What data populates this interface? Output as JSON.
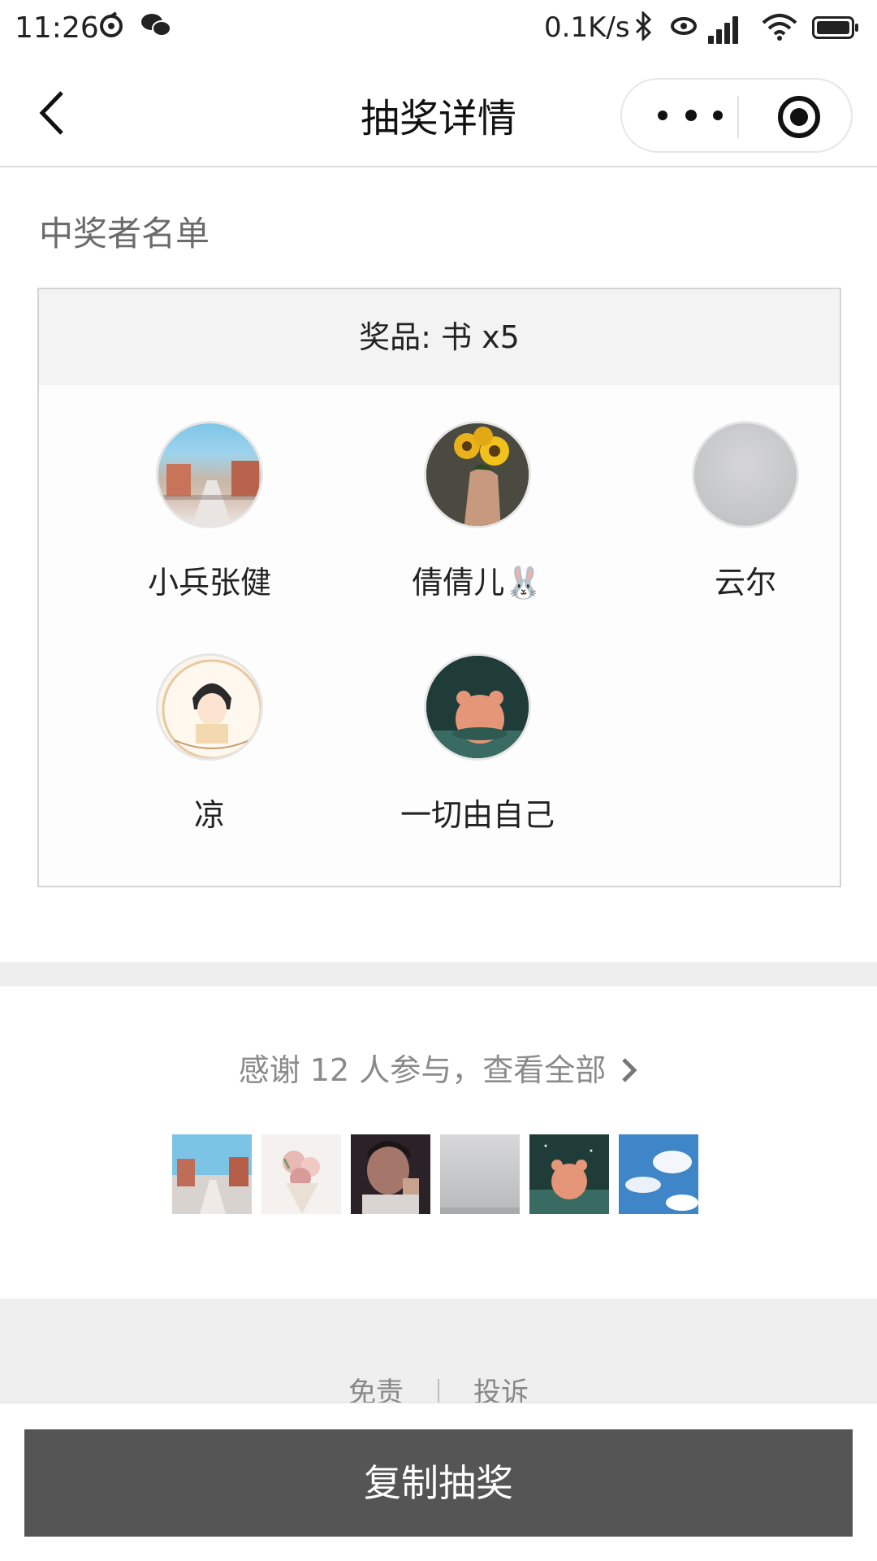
{
  "status_bar": {
    "time": "11:26",
    "net_speed": "0.1K/s",
    "icons": [
      "netease-music-icon",
      "wechat-icon",
      "bluetooth-icon",
      "alarm-icon",
      "signal-icon",
      "wifi-icon",
      "battery-icon"
    ]
  },
  "nav": {
    "title": "抽奖详情",
    "back_icon": "chevron-left-icon",
    "more_icon": "more-dots-icon",
    "close_icon": "target-close-icon"
  },
  "winners": {
    "section_title": "中奖者名单",
    "prize_label": "奖品: 书 x5",
    "list": [
      {
        "name": "小兵张健",
        "avatar": "street-scene"
      },
      {
        "name": "倩倩儿🐰",
        "avatar": "sunflowers"
      },
      {
        "name": "云尔",
        "avatar": "gray-fog"
      },
      {
        "name": "凉",
        "avatar": "anime-boy"
      },
      {
        "name": "一切由自己",
        "avatar": "bear-on-teal"
      }
    ]
  },
  "participants": {
    "thanks_text": "感谢 12 人参与，查看全部",
    "chevron_icon": "chevron-right-icon",
    "thumbnails": [
      "street-scene",
      "flowers",
      "selfie",
      "gray-fog",
      "bear-on-teal",
      "blue-sky-clouds"
    ]
  },
  "footer": {
    "disclaimer": "免责",
    "report": "投诉"
  },
  "cta": {
    "copy_label": "复制抽奖"
  },
  "colors": {
    "cta_bg": "#555555",
    "page_bg": "#ffffff",
    "gray_band": "#efeff0"
  }
}
